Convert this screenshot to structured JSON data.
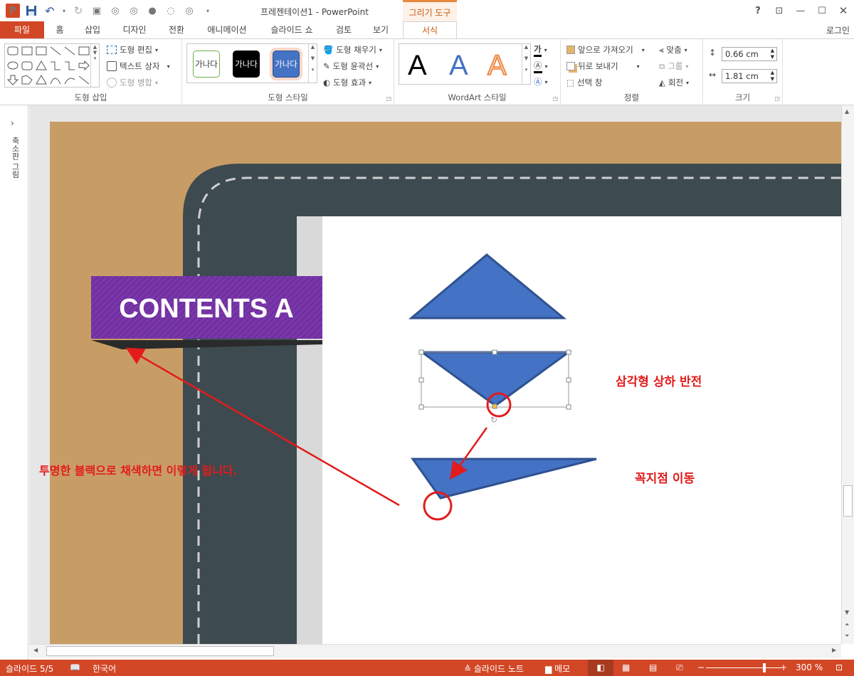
{
  "app": {
    "title": "프레젠테이션1 - PowerPoint",
    "context_tab_header": "그리기 도구",
    "login": "로그인"
  },
  "tabs": [
    {
      "label": "파일"
    },
    {
      "label": "홈"
    },
    {
      "label": "삽입"
    },
    {
      "label": "디자인"
    },
    {
      "label": "전환"
    },
    {
      "label": "애니메이션"
    },
    {
      "label": "슬라이드 쇼"
    },
    {
      "label": "검토"
    },
    {
      "label": "보기"
    },
    {
      "label": "서식"
    }
  ],
  "ribbon": {
    "insert_shapes": {
      "label": "도형 삽입",
      "edit_shape": "도형 편집",
      "text_box": "텍스트 상자",
      "merge_shapes": "도형 병합"
    },
    "shape_styles": {
      "label": "도형 스타일",
      "preset_text": "가나다",
      "fill": "도형 채우기",
      "outline": "도형 윤곽선",
      "effects": "도형 효과"
    },
    "wordart": {
      "label": "WordArt 스타일",
      "sample": "A",
      "text_fill_glyph": "가"
    },
    "arrange": {
      "label": "정렬",
      "bring_forward": "앞으로 가져오기",
      "send_backward": "뒤로 보내기",
      "selection_pane": "선택 창",
      "align": "맞춤",
      "group": "그룹",
      "rotate": "회전"
    },
    "size": {
      "label": "크기",
      "height": "0.66 cm",
      "width": "1.81 cm"
    }
  },
  "left_pane": {
    "label": "축소판 그림"
  },
  "slide": {
    "banner_title": "CONTENTS A",
    "annotation_flip": "삼각형 상하 반전",
    "annotation_vertex": "꼭지점 이동",
    "annotation_black": "투명한 블랙으로 채색하면 이렇게 됩니다."
  },
  "status": {
    "slide_index": "슬라이드 5/5",
    "language": "한국어",
    "notes": "슬라이드 노트",
    "comments": "메모",
    "zoom": "300 %"
  },
  "colors": {
    "accent": "#d24726",
    "tab_active": "#c55a11",
    "road": "#3d4a50",
    "sand": "#c89d65",
    "shape_fill": "#4472c4",
    "shape_outline": "#2f528f",
    "banner": "#7030a0",
    "annotation": "#e31b1b"
  }
}
